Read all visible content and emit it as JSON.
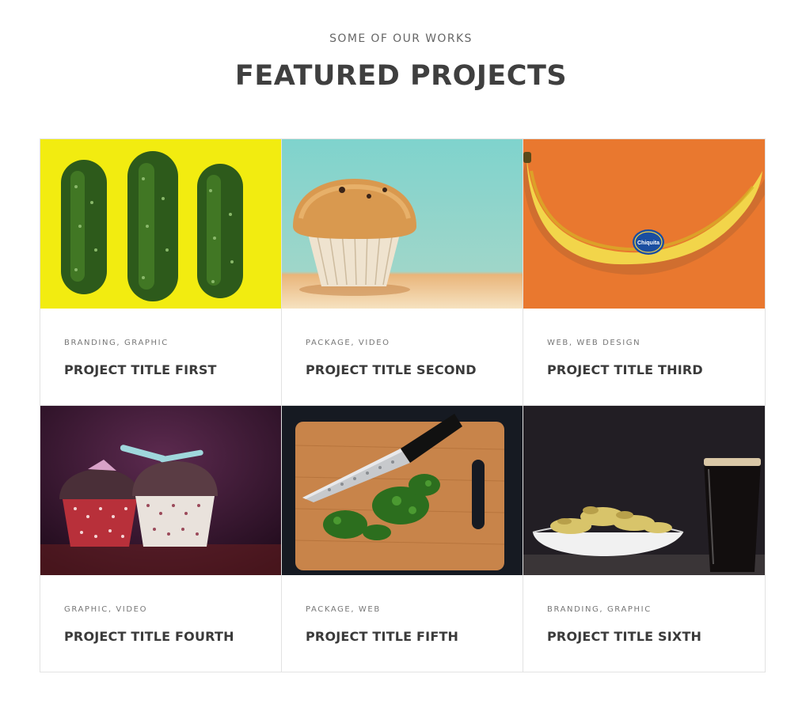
{
  "header": {
    "kicker": "SOME OF OUR WORKS",
    "title": "FEATURED PROJECTS"
  },
  "projects": [
    {
      "categories": "BRANDING, GRAPHIC",
      "title": "PROJECT TITLE FIRST",
      "image": "cucumbers-image"
    },
    {
      "categories": "PACKAGE, VIDEO",
      "title": "PROJECT TITLE SECOND",
      "image": "muffin-image"
    },
    {
      "categories": "WEB, WEB DESIGN",
      "title": "PROJECT TITLE THIRD",
      "image": "banana-image"
    },
    {
      "categories": "GRAPHIC, VIDEO",
      "title": "PROJECT TITLE FOURTH",
      "image": "cupcakes-image"
    },
    {
      "categories": "PACKAGE, WEB",
      "title": "PROJECT TITLE FIFTH",
      "image": "knife-board-image"
    },
    {
      "categories": "BRANDING, GRAPHIC",
      "title": "PROJECT TITLE SIXTH",
      "image": "chips-beer-image"
    }
  ],
  "banana_sticker_text": "Chiquita"
}
